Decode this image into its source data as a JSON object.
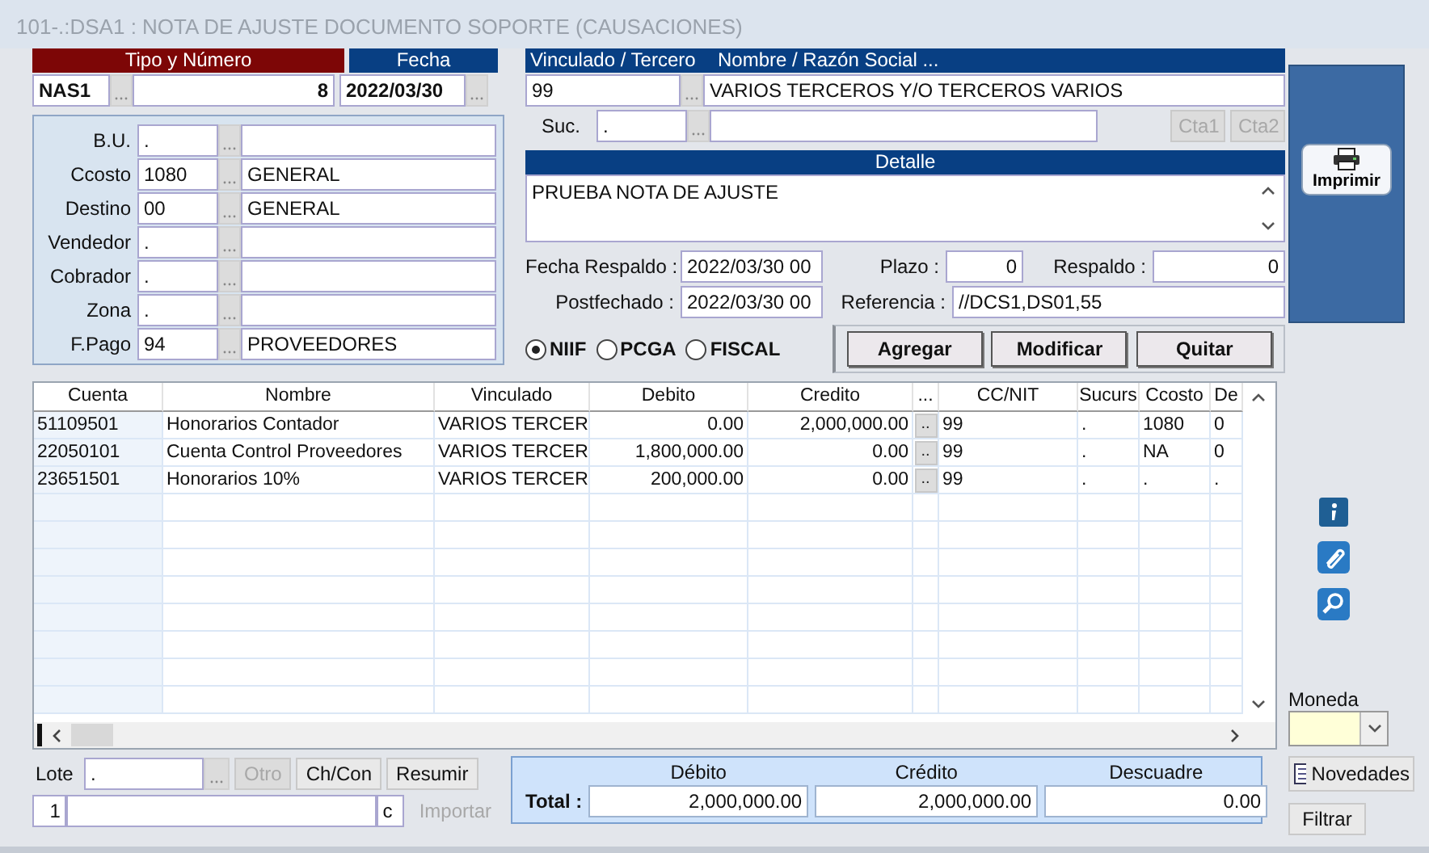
{
  "window": {
    "title": "101-.:DSA1 : NOTA DE AJUSTE DOCUMENTO SOPORTE (CAUSACIONES)"
  },
  "doc": {
    "tipo_header": "Tipo y Número",
    "tipo": "NAS1",
    "numero": "8",
    "fecha_header": "Fecha",
    "fecha": "2022/03/30"
  },
  "fields": [
    {
      "label": "B.U.",
      "code": "."
    },
    {
      "label": "Ccosto",
      "code": "1080",
      "name": "GENERAL"
    },
    {
      "label": "Destino",
      "code": "00",
      "name": "GENERAL"
    },
    {
      "label": "Vendedor",
      "code": "."
    },
    {
      "label": "Cobrador",
      "code": "."
    },
    {
      "label": "Zona",
      "code": "."
    },
    {
      "label": "F.Pago",
      "code": "94",
      "name": "PROVEEDORES"
    }
  ],
  "tercero": {
    "header": "Vinculado / Tercero",
    "name_header": "Nombre / Razón Social ...",
    "code": "99",
    "name": "VARIOS TERCEROS Y/O TERCEROS VARIOS",
    "suc_label": "Suc.",
    "suc": ".",
    "buttons": [
      {
        "label": "Cta1",
        "disabled": true
      },
      {
        "label": "Cta2",
        "disabled": true
      }
    ]
  },
  "detalle": {
    "header": "Detalle",
    "text": "PRUEBA NOTA DE AJUSTE"
  },
  "fecha_respaldo": {
    "label": "Fecha Respaldo :",
    "value": "2022/03/30 00"
  },
  "postfechado": {
    "label": "Postfechado :",
    "value": "2022/03/30 00"
  },
  "plazo": {
    "label": "Plazo :",
    "value": "0"
  },
  "respaldo": {
    "label": "Respaldo :",
    "value": "0"
  },
  "referencia": {
    "label": "Referencia :",
    "value": "//DCS1,DS01,55"
  },
  "radios": [
    {
      "label": "NIIF",
      "selected": true
    },
    {
      "label": "PCGA",
      "selected": false
    },
    {
      "label": "FISCAL",
      "selected": false
    }
  ],
  "actions": [
    "Agregar",
    "Modificar",
    "Quitar"
  ],
  "print_button": "Imprimir",
  "table": {
    "columns": [
      "Cuenta",
      "Nombre",
      "Vinculado",
      "Debito",
      "Credito",
      "...",
      "CC/NIT",
      "Sucurs",
      "Ccosto",
      "De"
    ],
    "rows": [
      [
        "51109501",
        "Honorarios Contador",
        "VARIOS TERCER",
        "0.00",
        "2,000,000.00",
        "..",
        "99",
        ".",
        "1080",
        "0"
      ],
      [
        "22050101",
        "Cuenta Control Proveedores",
        "VARIOS TERCER",
        "1,800,000.00",
        "0.00",
        "..",
        "99",
        ".",
        "NA",
        "0"
      ],
      [
        "23651501",
        "Honorarios 10%",
        "VARIOS TERCER",
        "200,000.00",
        "0.00",
        "..",
        "99",
        ".",
        ".",
        "."
      ]
    ]
  },
  "moneda": {
    "label": "Moneda"
  },
  "side_buttons": [
    "Novedades",
    "Filtrar"
  ],
  "lote": {
    "label": "Lote",
    "value": ".",
    "number": "1",
    "suffix": "c"
  },
  "lote_buttons": [
    {
      "label": "Otro",
      "disabled": true
    },
    {
      "label": "Ch/Con",
      "disabled": false
    },
    {
      "label": "Resumir",
      "disabled": false
    },
    {
      "label": "Importar",
      "disabled": true
    }
  ],
  "totals": {
    "label": "Total :",
    "columns": [
      {
        "header": "Débito",
        "value": "2,000,000.00"
      },
      {
        "header": "Crédito",
        "value": "2,000,000.00"
      },
      {
        "header": "Descuadre",
        "value": "0.00"
      }
    ]
  }
}
